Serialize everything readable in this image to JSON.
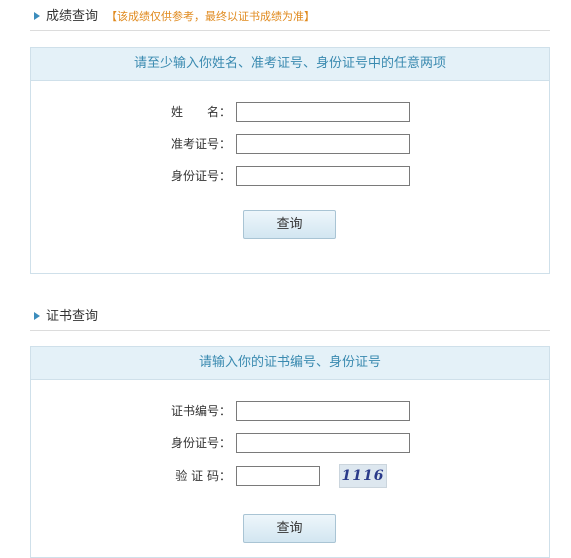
{
  "score_section": {
    "title": "成绩查询",
    "note": "【该成绩仅供参考，最终以证书成绩为准】",
    "panel_header": "请至少输入你姓名、准考证号、身份证号中的任意两项",
    "fields": [
      {
        "label": "姓　　名：",
        "value": ""
      },
      {
        "label": "准考证号：",
        "value": ""
      },
      {
        "label": "身份证号：",
        "value": ""
      }
    ],
    "query_label": "查询"
  },
  "cert_section": {
    "title": "证书查询",
    "panel_header": "请输入你的证书编号、身份证号",
    "fields": [
      {
        "label": "证书编号：",
        "value": ""
      },
      {
        "label": "身份证号：",
        "value": ""
      },
      {
        "label": "验 证 码：",
        "value": ""
      }
    ],
    "captcha_text": "1116",
    "query_label": "查询"
  }
}
